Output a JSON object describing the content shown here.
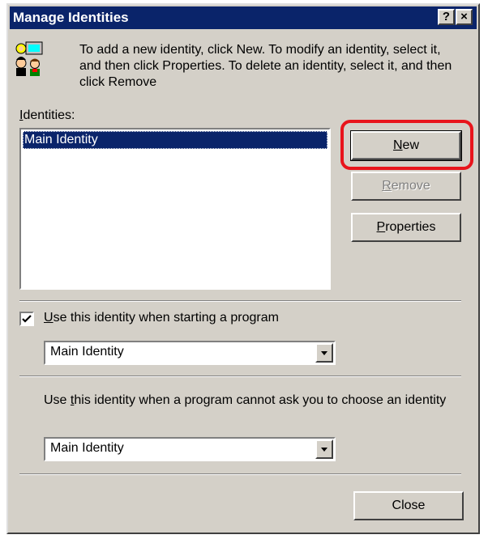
{
  "window": {
    "title": "Manage Identities",
    "help_label": "?",
    "close_label": "×"
  },
  "intro_text": "To add a new identity, click New.  To modify an identity, select it, and then click Properties.  To delete an identity, select it, and then click Remove",
  "identities": {
    "label_accel": "I",
    "label_rest": "dentities:",
    "items": [
      "Main Identity"
    ]
  },
  "buttons": {
    "new_accel": "N",
    "new_rest": "ew",
    "remove_accel": "R",
    "remove_rest": "emove",
    "properties_accel": "P",
    "properties_rest": "roperties",
    "close": "Close"
  },
  "startup": {
    "checked": true,
    "label_accel": "U",
    "label_rest": "se this identity when starting a program",
    "selected": "Main Identity"
  },
  "fallback": {
    "label_pre": "Use ",
    "label_accel": "t",
    "label_rest": "his identity when a program cannot ask you to choose an identity",
    "selected": "Main Identity"
  },
  "colors": {
    "highlight_ring": "#e8141b",
    "selection": "#0a246a",
    "titlebar": "#0a246a",
    "face": "#d4d0c8"
  }
}
